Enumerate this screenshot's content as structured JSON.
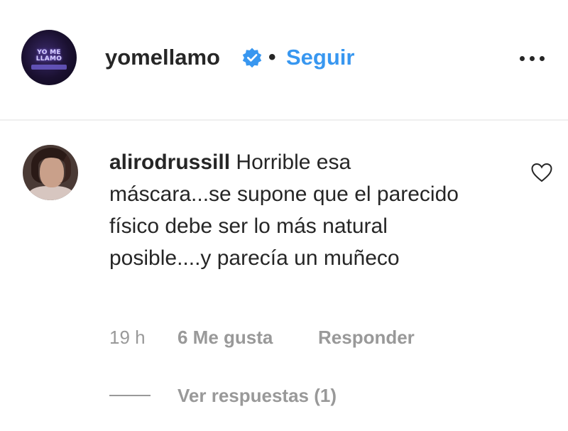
{
  "header": {
    "username": "yomellamo",
    "verified_icon": "verified-badge-icon",
    "separator": "•",
    "follow_label": "Seguir",
    "more_icon": "more-options-icon",
    "avatar_logo_text": "YO ME LLAMO"
  },
  "comment": {
    "username": "alirodrussill",
    "text": "Horrible esa máscara...se supone que el parecido físico debe ser lo más natural posible....y parecía un muñeco",
    "time": "19 h",
    "likes": "6 Me gusta",
    "reply_label": "Responder",
    "heart_icon": "heart-outline-icon"
  },
  "replies": {
    "label": "Ver respuestas (1)"
  },
  "colors": {
    "link_blue": "#3897f0",
    "text_primary": "#262626",
    "text_secondary": "#999999",
    "divider": "#efefef"
  }
}
